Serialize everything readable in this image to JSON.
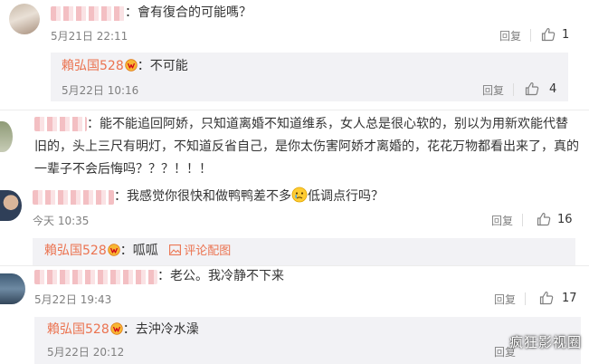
{
  "comments": [
    {
      "text": "：會有復合的可能嗎？",
      "time": "5月21日 22:11",
      "reply_label": "回复",
      "likes": "1",
      "replies": [
        {
          "user": "賴弘国528",
          "text": "：不可能",
          "time": "5月22日 10:16",
          "reply_label": "回复",
          "likes": "4"
        }
      ]
    },
    {
      "text": "：能不能追回阿娇，只知道离婚不知道维系，女人总是很心软的，别以为用新欢能代替旧的，头上三尺有明灯，不知道反省自己，是你太伤害阿娇才离婚的，花花万物都看出来了，真的一辈子不会后悔吗？？？！！！",
      "line1": "：能不能追回阿娇，只知道离婚不知道维系，女人总是很心软的，别以为用新欢能代替",
      "line2": "旧的，头上三尺有明灯，不知道反省自己，是你太伤害阿娇才离婚的，花花万物都看出来了，真的",
      "line3": "一辈子不会后悔吗？？？！！！"
    },
    {
      "text_before": "：我感觉你很快和做鸭鸭差不多",
      "text_after": "低调点行吗？",
      "time": "今天 10:35",
      "reply_label": "回复",
      "likes": "16",
      "replies": [
        {
          "user": "賴弘国528",
          "text": "：呱呱",
          "pic_label": "评论配图"
        }
      ]
    },
    {
      "text": "：老公。我冷静不下来",
      "time": "5月22日 19:43",
      "reply_label": "回复",
      "likes": "17",
      "replies": [
        {
          "user": "賴弘国528",
          "text": "：去沖冷水澡",
          "time": "5月22日 20:12",
          "reply_label": "回复"
        }
      ]
    }
  ],
  "watermark": "疯狂影视圈",
  "colors": {
    "link": "#eb7350",
    "reply_bg": "#f2f2f5",
    "muted": "#808080"
  },
  "icons": {
    "like": "thumbs-up-icon",
    "vip": "vip-badge-icon",
    "pic": "picture-icon",
    "emoji": "crying-face-emoji"
  }
}
